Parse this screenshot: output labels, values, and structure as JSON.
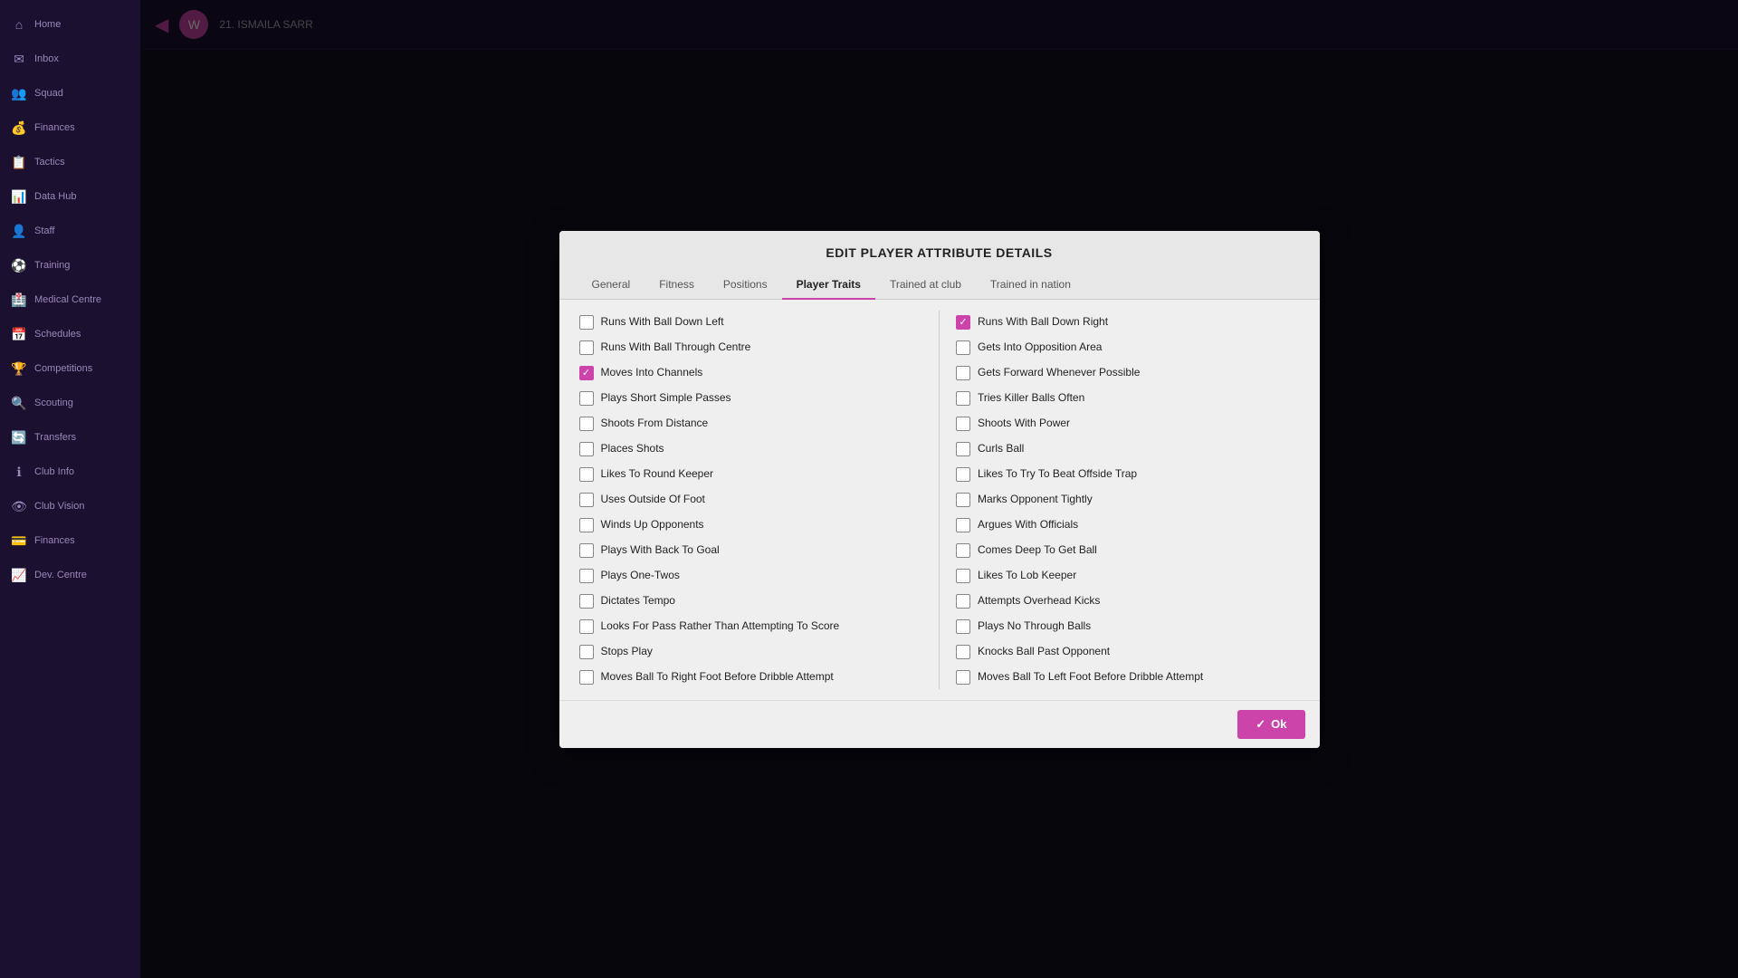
{
  "modal": {
    "title": "EDIT PLAYER ATTRIBUTE DETAILS",
    "tabs": [
      {
        "id": "general",
        "label": "General",
        "active": false
      },
      {
        "id": "fitness",
        "label": "Fitness",
        "active": false
      },
      {
        "id": "positions",
        "label": "Positions",
        "active": false
      },
      {
        "id": "player-traits",
        "label": "Player Traits",
        "active": true
      },
      {
        "id": "trained-at-club",
        "label": "Trained at club",
        "active": false
      },
      {
        "id": "trained-in-nation",
        "label": "Trained in nation",
        "active": false
      }
    ],
    "ok_label": "Ok",
    "left_traits": [
      {
        "id": "runs-ball-down-left",
        "label": "Runs With Ball Down Left",
        "checked": false
      },
      {
        "id": "runs-ball-through-centre",
        "label": "Runs With Ball Through Centre",
        "checked": false
      },
      {
        "id": "moves-into-channels",
        "label": "Moves Into Channels",
        "checked": true
      },
      {
        "id": "plays-short-simple-passes",
        "label": "Plays Short Simple Passes",
        "checked": false
      },
      {
        "id": "shoots-from-distance",
        "label": "Shoots From Distance",
        "checked": false
      },
      {
        "id": "places-shots",
        "label": "Places Shots",
        "checked": false
      },
      {
        "id": "likes-to-round-keeper",
        "label": "Likes To Round Keeper",
        "checked": false
      },
      {
        "id": "uses-outside-of-foot",
        "label": "Uses Outside Of Foot",
        "checked": false
      },
      {
        "id": "winds-up-opponents",
        "label": "Winds Up Opponents",
        "checked": false
      },
      {
        "id": "plays-with-back-to-goal",
        "label": "Plays With Back To Goal",
        "checked": false
      },
      {
        "id": "plays-one-twos",
        "label": "Plays One-Twos",
        "checked": false
      },
      {
        "id": "dictates-tempo",
        "label": "Dictates Tempo",
        "checked": false
      },
      {
        "id": "looks-for-pass-rather-than-attempting",
        "label": "Looks For Pass Rather Than Attempting To Score",
        "checked": false
      },
      {
        "id": "stops-play",
        "label": "Stops Play",
        "checked": false
      },
      {
        "id": "moves-ball-to-right-foot",
        "label": "Moves Ball To Right Foot Before Dribble Attempt",
        "checked": false
      }
    ],
    "right_traits": [
      {
        "id": "runs-ball-down-right",
        "label": "Runs With Ball Down Right",
        "checked": true
      },
      {
        "id": "gets-into-opposition-area",
        "label": "Gets Into Opposition Area",
        "checked": false
      },
      {
        "id": "gets-forward-whenever-possible",
        "label": "Gets Forward Whenever Possible",
        "checked": false
      },
      {
        "id": "tries-killer-balls-often",
        "label": "Tries Killer Balls Often",
        "checked": false
      },
      {
        "id": "shoots-with-power",
        "label": "Shoots With Power",
        "checked": false
      },
      {
        "id": "curls-ball",
        "label": "Curls Ball",
        "checked": false
      },
      {
        "id": "likes-to-try-to-beat-offside-trap",
        "label": "Likes To Try To Beat Offside Trap",
        "checked": false
      },
      {
        "id": "marks-opponent-tightly",
        "label": "Marks Opponent Tightly",
        "checked": false
      },
      {
        "id": "argues-with-officials",
        "label": "Argues With Officials",
        "checked": false
      },
      {
        "id": "comes-deep-to-get-ball",
        "label": "Comes Deep To Get Ball",
        "checked": false
      },
      {
        "id": "likes-to-lob-keeper",
        "label": "Likes To Lob Keeper",
        "checked": false
      },
      {
        "id": "attempts-overhead-kicks",
        "label": "Attempts Overhead Kicks",
        "checked": false
      },
      {
        "id": "plays-no-through-balls",
        "label": "Plays No Through Balls",
        "checked": false
      },
      {
        "id": "knocks-ball-past-opponent",
        "label": "Knocks Ball Past Opponent",
        "checked": false
      },
      {
        "id": "moves-ball-to-left-foot",
        "label": "Moves Ball To Left Foot Before Dribble Attempt",
        "checked": false
      }
    ]
  },
  "sidebar": {
    "items": [
      {
        "id": "home",
        "label": "Home",
        "icon": "⌂"
      },
      {
        "id": "inbox",
        "label": "Inbox",
        "icon": "✉"
      },
      {
        "id": "squad",
        "label": "Squad",
        "icon": "👥"
      },
      {
        "id": "finances",
        "label": "Finances",
        "icon": "💰"
      },
      {
        "id": "tactics",
        "label": "Tactics",
        "icon": "📋"
      },
      {
        "id": "data-hub",
        "label": "Data Hub",
        "icon": "📊"
      },
      {
        "id": "staff",
        "label": "Staff",
        "icon": "👤"
      },
      {
        "id": "training",
        "label": "Training",
        "icon": "⚽"
      },
      {
        "id": "medical-centre",
        "label": "Medical Centre",
        "icon": "🏥"
      },
      {
        "id": "schedules",
        "label": "Schedules",
        "icon": "📅"
      },
      {
        "id": "competitions",
        "label": "Competitions",
        "icon": "🏆"
      },
      {
        "id": "scouting",
        "label": "Scouting",
        "icon": "🔍"
      },
      {
        "id": "transfers",
        "label": "Transfers",
        "icon": "🔄"
      },
      {
        "id": "club-info",
        "label": "Club Info",
        "icon": "ℹ"
      },
      {
        "id": "club-vision",
        "label": "Club Vision",
        "icon": "👁"
      },
      {
        "id": "finances2",
        "label": "Finances",
        "icon": "💳"
      },
      {
        "id": "dev-centre",
        "label": "Dev. Centre",
        "icon": "📈"
      }
    ]
  }
}
